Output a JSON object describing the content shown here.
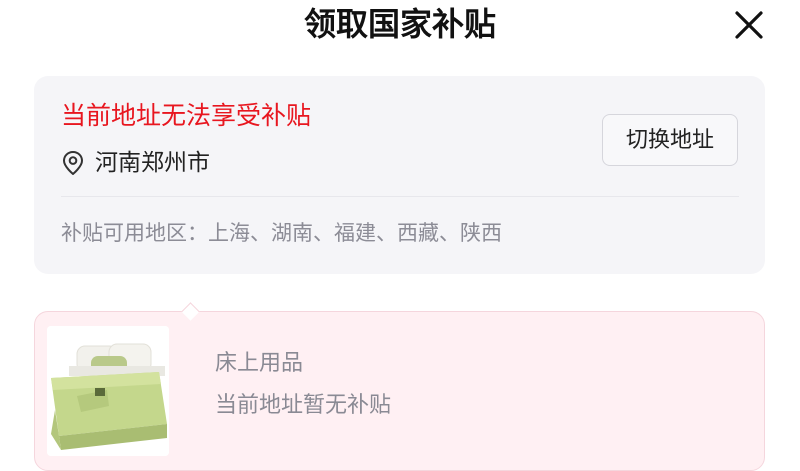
{
  "header": {
    "title": "领取国家补贴"
  },
  "address_card": {
    "warning": "当前地址无法享受补贴",
    "address": "河南郑州市",
    "switch_button_label": "切换地址",
    "regions_label": "补贴可用地区：",
    "regions": [
      "上海",
      "湖南",
      "福建",
      "西藏",
      "陕西"
    ],
    "regions_text": "补贴可用地区：上海、湖南、福建、西藏、陕西"
  },
  "product": {
    "name": "床上用品",
    "status": "当前地址暂无补贴"
  },
  "colors": {
    "warning_red": "#e8161f",
    "card_grey": "#f5f5f8",
    "product_pink": "#fff0f3"
  },
  "icons": {
    "close": "close-icon",
    "location": "location-pin-icon"
  }
}
